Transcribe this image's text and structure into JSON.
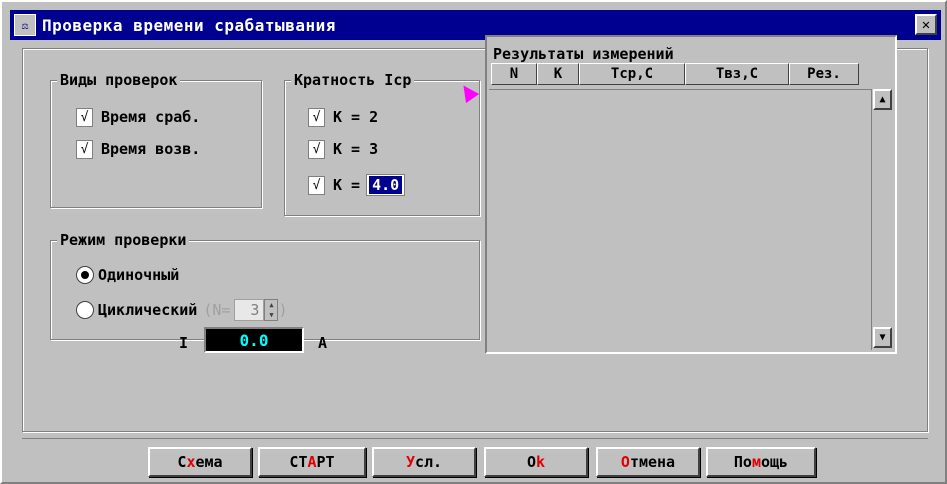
{
  "window": {
    "title": "Проверка времени срабатывания",
    "icon": "scales-icon",
    "close_glyph": "✕"
  },
  "checks_group": {
    "legend": "Виды проверок",
    "items": [
      {
        "label": "Время сраб.",
        "checked": true,
        "mark": "√"
      },
      {
        "label": "Время возв.",
        "checked": true,
        "mark": "√"
      }
    ]
  },
  "multiplicity_group": {
    "legend": "Кратность Iср",
    "items": [
      {
        "label": "K = 2",
        "checked": true,
        "mark": "√"
      },
      {
        "label": "K = 3",
        "checked": true,
        "mark": "√"
      },
      {
        "label": "K =",
        "checked": true,
        "mark": "√",
        "value": "4.0"
      }
    ]
  },
  "mode_group": {
    "legend": "Режим проверки",
    "single_label": "Одиночный",
    "cyclic_label": "Циклический",
    "cyclic_n_prefix": "(N=",
    "cyclic_n_value": "3",
    "cyclic_n_suffix": ")",
    "selected": "single"
  },
  "current": {
    "label": "I",
    "value": "0.0",
    "unit": "A"
  },
  "results": {
    "title": "Результаты измерений",
    "columns": [
      "N",
      "K",
      "Tср,С",
      "Tвз,С",
      "Рез."
    ],
    "rows": []
  },
  "buttons": {
    "schema": {
      "pre": "С",
      "hot": "х",
      "post": "ема"
    },
    "start": {
      "pre": "СТ",
      "hot": "А",
      "post": "РТ"
    },
    "cond": {
      "pre": "",
      "hot": "У",
      "post": "сл."
    },
    "ok": {
      "pre": "O",
      "hot": "k",
      "post": ""
    },
    "cancel": {
      "pre": "",
      "hot": "О",
      "post": "тмена"
    },
    "help": {
      "pre": "По",
      "hot": "м",
      "post": "ощь"
    }
  },
  "colors": {
    "titlebar": "#000090",
    "face": "#c0c0c0",
    "hotkey": "#e00000",
    "current_text": "#00ffff"
  }
}
